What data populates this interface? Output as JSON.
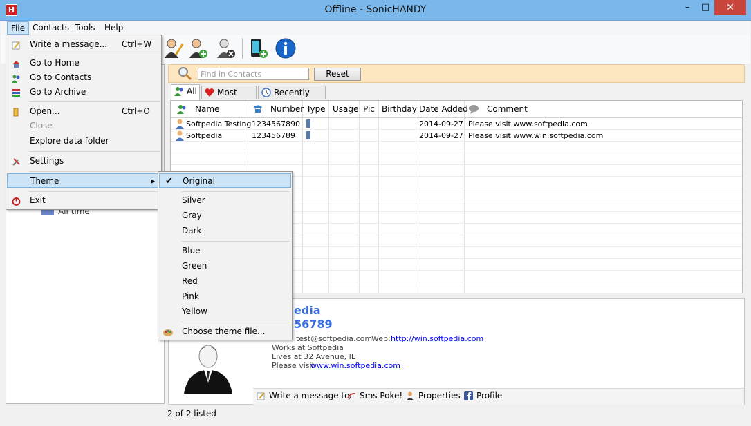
{
  "window": {
    "title": "Offline - SonicHANDY",
    "app_icon_letter": "H",
    "minimize": "–",
    "maximize": "□",
    "close": "✕"
  },
  "menubar": {
    "file": "File",
    "contacts": "Contacts",
    "tools": "Tools",
    "help": "Help"
  },
  "file_menu": {
    "write_message": "Write a message...",
    "write_message_shortcut": "Ctrl+W",
    "go_home": "Go to Home",
    "go_contacts": "Go to Contacts",
    "go_archive": "Go to Archive",
    "open": "Open...",
    "open_shortcut": "Ctrl+O",
    "close": "Close",
    "explore": "Explore data folder",
    "settings": "Settings",
    "theme": "Theme",
    "exit": "Exit"
  },
  "theme_menu": {
    "original": "Original",
    "silver": "Silver",
    "gray": "Gray",
    "dark": "Dark",
    "blue": "Blue",
    "green": "Green",
    "red": "Red",
    "pink": "Pink",
    "yellow": "Yellow",
    "choose": "Choose theme file..."
  },
  "left_panel": {
    "all_time": "All time"
  },
  "search": {
    "placeholder": "Find in Contacts",
    "reset_label": "Reset"
  },
  "tabs": {
    "all": "All",
    "most_used": "Most used",
    "recently_used": "Recently used"
  },
  "grid": {
    "columns": [
      "Name",
      "Number",
      "Type",
      "Usage",
      "Pic",
      "Birthday",
      "Date Added",
      "Comment"
    ],
    "rows": [
      {
        "name": "Softpedia Testing",
        "number": "1234567890",
        "date_added": "2014-09-27",
        "comment": "Please visit www.softpedia.com"
      },
      {
        "name": "Softpedia",
        "number": "123456789",
        "date_added": "2014-09-27",
        "comment": "Please visit www.win.softpedia.com"
      }
    ]
  },
  "detail": {
    "name_fragment": "edia",
    "number_fragment": "56789",
    "email_fragment": "test@softpedia.com",
    "web_label": "Web:",
    "web_url": "http://win.softpedia.com",
    "works_at": "Works at Softpedia",
    "lives_at": "Lives at 32 Avenue, IL",
    "visit_prefix": "Please visit",
    "visit_link": "www.win.softpedia.com",
    "actions": {
      "write": "Write a message to",
      "sms": "Sms Poke!",
      "properties": "Properties",
      "profile": "Profile"
    }
  },
  "status": {
    "listed": "2 of 2 listed"
  },
  "colors": {
    "titlebar": "#7ab7ea",
    "searchbar": "#fde7c0",
    "highlight": "#cce4f7",
    "accent_name": "#3a6ee0"
  }
}
